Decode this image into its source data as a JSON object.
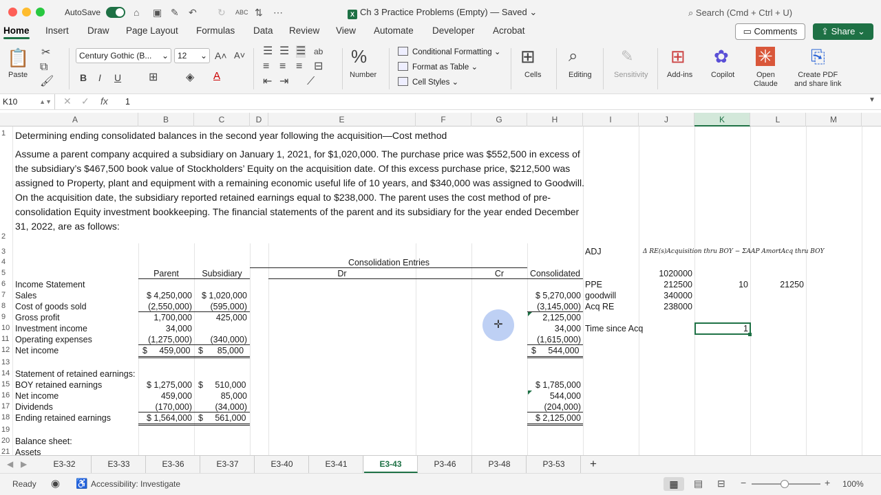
{
  "titlebar": {
    "autosave_label": "AutoSave",
    "doc_title": "Ch 3 Practice Problems (Empty) — Saved ⌄",
    "search_placeholder": "Search (Cmd + Ctrl + U)"
  },
  "ribbon_tabs": [
    "Home",
    "Insert",
    "Draw",
    "Page Layout",
    "Formulas",
    "Data",
    "Review",
    "View",
    "Automate",
    "Developer",
    "Acrobat"
  ],
  "buttons": {
    "comments": "Comments",
    "share": "Share"
  },
  "ribbon": {
    "paste": "Paste",
    "font": "Century Gothic (B...",
    "font_size": "12",
    "number": "Number",
    "conditional_formatting": "Conditional Formatting",
    "format_as_table": "Format as Table",
    "cell_styles": "Cell Styles",
    "cells": "Cells",
    "editing": "Editing",
    "sensitivity": "Sensitivity",
    "addins": "Add-ins",
    "copilot": "Copilot",
    "open_claude": "Open\nClaude",
    "create_pdf": "Create PDF\nand share link"
  },
  "formula_bar": {
    "name_box": "K10",
    "fx": "fx",
    "value": "1"
  },
  "columns": [
    "A",
    "B",
    "C",
    "D",
    "E",
    "F",
    "G",
    "H",
    "I",
    "J",
    "K",
    "L",
    "M"
  ],
  "sheet": {
    "title": "Determining ending consolidated balances in the second year following the acquisition—Cost method",
    "paragraph": "Assume a parent company acquired a subsidiary on January 1, 2021, for $1,020,000. The purchase price was $552,500 in excess of the subsidiary’s $467,500 book value of Stockholders’ Equity on the acquisition date. Of this excess purchase price, $212,500 was assigned to Property, plant and equipment with a remaining economic useful life of 10 years, and $340,000 was assigned to Goodwill. On the acquisition date, the subsidiary reported retained earnings equal to $238,000. The parent uses the cost method of pre-consolidation Equity investment bookkeeping. The financial statements of the parent and its subsidiary for the year ended December 31, 2022, are as follows:",
    "adj": "ADJ",
    "formula_label": "Δ RE(s)Acquisition thru BOY − ΣAAP AmortAcq thru BOY",
    "consolidation_entries": "Consolidation Entries",
    "hdr_parent": "Parent",
    "hdr_subsidiary": "Subsidiary",
    "hdr_dr": "Dr",
    "hdr_cr": "Cr",
    "hdr_consolidated": "Consolidated",
    "income_statement": "Income Statement",
    "rows": [
      {
        "label": "Sales",
        "parent": "$ 4,250,000",
        "sub": "$ 1,020,000",
        "cons": "$ 5,270,000"
      },
      {
        "label": "Cost of goods sold",
        "parent": "(2,550,000)",
        "sub": "(595,000)",
        "cons": "(3,145,000)"
      },
      {
        "label": "Gross profit",
        "parent": "1,700,000",
        "sub": "425,000",
        "cons": "2,125,000"
      },
      {
        "label": "Investment income",
        "parent": "34,000",
        "sub": "",
        "cons": "34,000"
      },
      {
        "label": "Operating expenses",
        "parent": "(1,275,000)",
        "sub": "(340,000)",
        "cons": "(1,615,000)"
      },
      {
        "label": "Net income",
        "parent": "$     459,000",
        "sub": "$      85,000",
        "cons": "$     544,000"
      }
    ],
    "re_title": "Statement of retained earnings:",
    "re_rows": [
      {
        "label": "BOY retained earnings",
        "parent": "$ 1,275,000",
        "sub": "$     510,000",
        "cons": "$ 1,785,000"
      },
      {
        "label": "Net income",
        "parent": "459,000",
        "sub": "85,000",
        "cons": "544,000"
      },
      {
        "label": "Dividends",
        "parent": "(170,000)",
        "sub": "(34,000)",
        "cons": "(204,000)"
      },
      {
        "label": "Ending retained earnings",
        "parent": "$ 1,564,000",
        "sub": "$     561,000",
        "cons": "$ 2,125,000"
      }
    ],
    "balance_sheet": "Balance sheet:",
    "assets": "Assets",
    "side": {
      "j5": "1020000",
      "i6": "PPE",
      "j6": "212500",
      "k6": "10",
      "l6": "21250",
      "i7": "goodwill",
      "j7": "340000",
      "i8": "Acq RE",
      "j8": "238000",
      "i10": "Time since Acq",
      "k10": "1"
    }
  },
  "sheet_tabs": [
    "E3-32",
    "E3-33",
    "E3-36",
    "E3-37",
    "E3-40",
    "E3-41",
    "E3-43",
    "P3-46",
    "P3-48",
    "P3-53"
  ],
  "active_sheet": "E3-43",
  "status": {
    "ready": "Ready",
    "accessibility": "Accessibility: Investigate",
    "zoom": "100%"
  }
}
